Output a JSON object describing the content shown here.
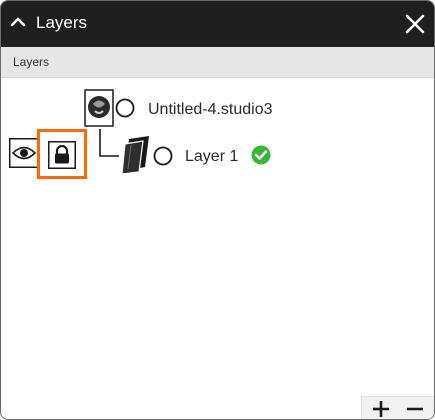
{
  "panel": {
    "title": "Layers",
    "subheader": "Layers"
  },
  "layers": [
    {
      "name": "Untitled-4.studio3",
      "icon": "document-icon",
      "level": 0
    },
    {
      "name": "Layer 1",
      "icon": "layer-stack-icon",
      "level": 1,
      "status_icon": "check-circle-icon"
    }
  ],
  "row_controls": {
    "visibility_icon": "eye-icon",
    "lock_icon": "lock-icon",
    "lock_highlight_color": "#ff6a00"
  },
  "footer": {
    "add_icon": "plus-icon",
    "remove_icon": "minus-icon"
  },
  "colors": {
    "titlebar": "#1f1f1f",
    "status_ok": "#3cb43c"
  }
}
